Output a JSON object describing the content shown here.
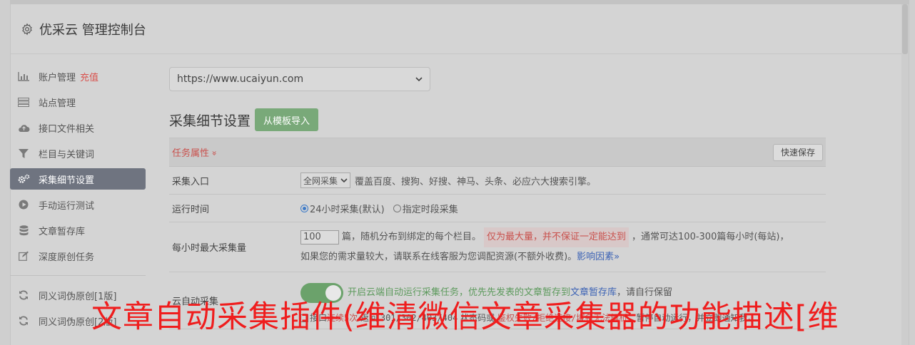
{
  "header": {
    "title": "优采云 管理控制台",
    "icon": "gear-icon"
  },
  "sidebar": {
    "items": [
      {
        "label": "账户管理",
        "extra": "充值",
        "icon": "bar-chart-icon"
      },
      {
        "label": "站点管理",
        "icon": "server-icon"
      },
      {
        "label": "接口文件相关",
        "icon": "cloud-upload-icon"
      },
      {
        "label": "栏目与关键词",
        "icon": "filter-icon"
      },
      {
        "label": "采集细节设置",
        "icon": "gears-icon",
        "active": true
      },
      {
        "label": "手动运行测试",
        "icon": "play-circle-icon"
      },
      {
        "label": "文章暂存库",
        "icon": "database-icon"
      },
      {
        "label": "深度原创任务",
        "icon": "edit-icon"
      }
    ],
    "items2": [
      {
        "label": "同义词伪原创[1版]",
        "icon": "refresh-icon"
      },
      {
        "label": "同义词伪原创[2版]",
        "icon": "refresh-icon"
      }
    ]
  },
  "main": {
    "site_select": "https://www.ucaiyun.com",
    "section_title": "采集细节设置",
    "import_label": "从模板导入",
    "panel": {
      "prop_label": "任务属性",
      "prop_chevron": "»",
      "save_label": "快速保存",
      "rows": {
        "entry": {
          "label": "采集入口",
          "select": "全网采集",
          "desc": "覆盖百度、搜狗、好搜、神马、头条、必应六大搜索引擎。"
        },
        "time": {
          "label": "运行时间",
          "opt1": "24小时采集(默认)",
          "opt2": "指定时段采集"
        },
        "max": {
          "label": "每小时最大采集量",
          "value": "100",
          "t1": "篇，随机分布到绑定的每个栏目。",
          "warn": "仅为最大量，并不保证一定能达到",
          "t2": "，通常可达100-300篇每小时(每站)，",
          "t3": "如果您的需求量较大，请联系在线客服为您调配资源(不额外收费)。",
          "link": "影响因素"
        },
        "auto": {
          "label": "云自动采集",
          "t1": "开启云端自动运行采集任务，优先先发表的文章暂存到",
          "link": "文章暂存库",
          "t2": "，请自行保留",
          "chk_label": "接口",
          "r1": "连续5次",
          "t3": "返回",
          "codes": "301/302/403/404",
          "t4": "状态码或",
          "r2": "鉴权失败/拒绝连接/域名无法解析",
          "t5": "，暂停自动运行，并立即通知我。"
        }
      }
    }
  },
  "overlay": {
    "text": "文章自动采集插件(维清微信文章采集器的功能描述[维"
  },
  "colors": {
    "active_bg": "#6f7480",
    "accent_red": "#c9514d",
    "button_green": "#79a979",
    "overlay_red": "#ef1d1d"
  }
}
